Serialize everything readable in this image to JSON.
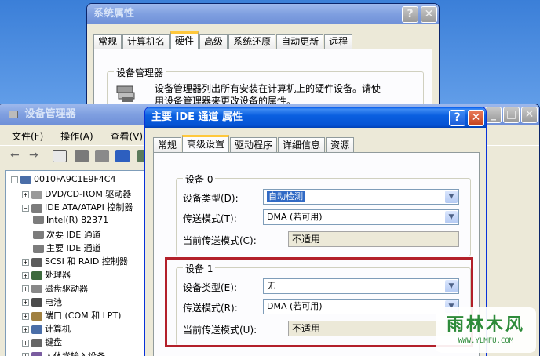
{
  "sysprops": {
    "title": "系统属性",
    "tabs": [
      "常规",
      "计算机名",
      "硬件",
      "高级",
      "系统还原",
      "自动更新",
      "远程"
    ],
    "section_label": "设备管理器",
    "description_line1": "设备管理器列出所有安装在计算机上的硬件设备。请使",
    "description_line2": "用设备管理器来更改设备的属性。",
    "help_btn": "?",
    "close_btn": "✕"
  },
  "devmgr": {
    "title": "设备管理器",
    "menu": [
      "文件(F)",
      "操作(A)",
      "查看(V)"
    ],
    "nav_back": "←",
    "nav_forward": "→",
    "tree": [
      {
        "label": "0010FA9C1E9F4C4",
        "level": 0,
        "expander": "−",
        "icon": "computer"
      },
      {
        "label": "DVD/CD-ROM 驱动器",
        "level": 1,
        "expander": "+",
        "icon": "cdrom"
      },
      {
        "label": "IDE ATA/ATAPI 控制器",
        "level": 1,
        "expander": "−",
        "icon": "ide"
      },
      {
        "label": "Intel(R) 82371",
        "level": 2,
        "expander": "",
        "icon": "ide"
      },
      {
        "label": "次要 IDE 通道",
        "level": 2,
        "expander": "",
        "icon": "ide"
      },
      {
        "label": "主要 IDE 通道",
        "level": 2,
        "expander": "",
        "icon": "ide"
      },
      {
        "label": "SCSI 和 RAID 控制器",
        "level": 1,
        "expander": "+",
        "icon": "scsi"
      },
      {
        "label": "处理器",
        "level": 1,
        "expander": "+",
        "icon": "cpu"
      },
      {
        "label": "磁盘驱动器",
        "level": 1,
        "expander": "+",
        "icon": "disk"
      },
      {
        "label": "电池",
        "level": 1,
        "expander": "+",
        "icon": "battery"
      },
      {
        "label": "端口 (COM 和 LPT)",
        "level": 1,
        "expander": "+",
        "icon": "port"
      },
      {
        "label": "计算机",
        "level": 1,
        "expander": "+",
        "icon": "computer"
      },
      {
        "label": "键盘",
        "level": 1,
        "expander": "+",
        "icon": "keyboard"
      },
      {
        "label": "人体学输入设备",
        "level": 1,
        "expander": "+",
        "icon": "hid"
      }
    ]
  },
  "ideprops": {
    "title": "主要 IDE 通道 属性",
    "tabs": [
      "常规",
      "高级设置",
      "驱动程序",
      "详细信息",
      "资源"
    ],
    "device0": {
      "group_label": "设备 0",
      "type_label": "设备类型(D):",
      "type_value": "自动检测",
      "mode_label": "传送模式(T):",
      "mode_value": "DMA (若可用)",
      "current_label": "当前传送模式(C):",
      "current_value": "不适用"
    },
    "device1": {
      "group_label": "设备 1",
      "type_label": "设备类型(E):",
      "type_value": "无",
      "mode_label": "传送模式(R):",
      "mode_value": "DMA (若可用)",
      "current_label": "当前传送模式(U):",
      "current_value": "不适用"
    }
  },
  "watermark": {
    "brand": "雨林木风",
    "url": "WWW.YLMFU.COM"
  },
  "colors": {
    "accent_red": "#b3202a",
    "watermark_green": "#2e8b3a"
  }
}
